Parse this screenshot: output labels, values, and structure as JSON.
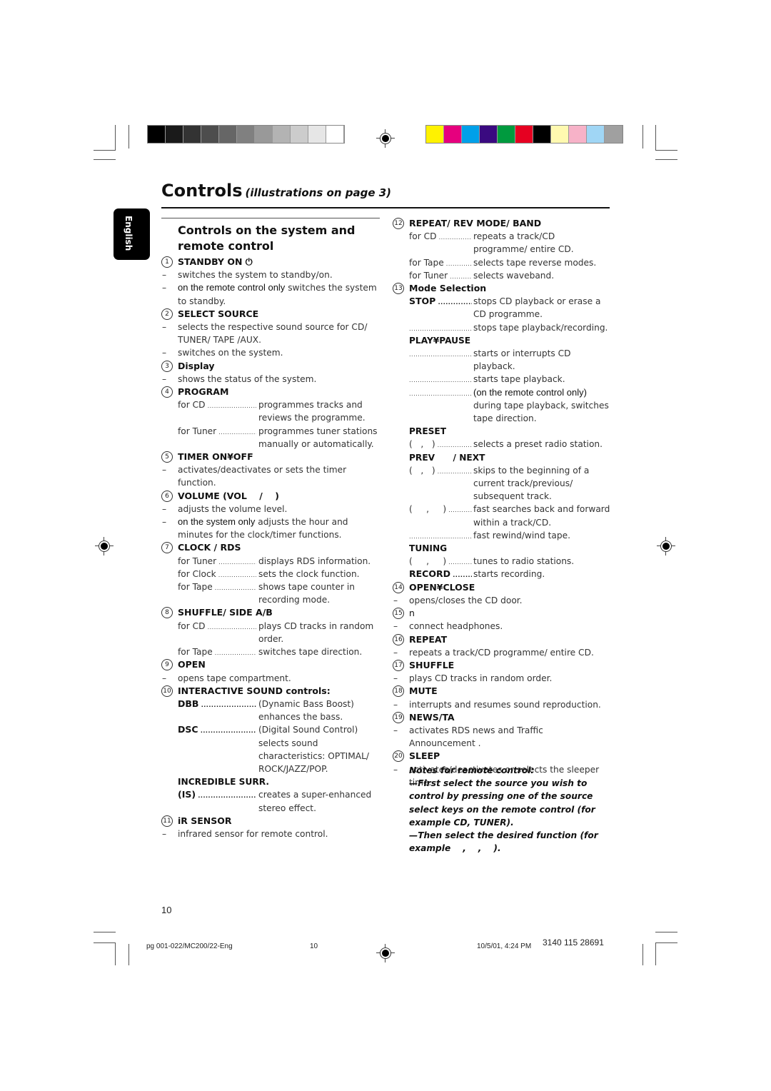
{
  "print_marks": {
    "gray_swatches": [
      "#000000",
      "#1a1a1a",
      "#333333",
      "#4d4d4d",
      "#666666",
      "#808080",
      "#999999",
      "#b3b3b3",
      "#cccccc",
      "#e6e6e6",
      "#ffffff"
    ],
    "color_swatches": [
      "#fff200",
      "#e6007e",
      "#00a0e9",
      "#3a0a80",
      "#009a3e",
      "#e60021",
      "#000000",
      "#fff9b0",
      "#f7b2c8",
      "#a0d6f5",
      "#a0a0a0"
    ]
  },
  "header": {
    "title": "Controls",
    "subtitle": "(illustrations on page 3)",
    "language_tab": "English"
  },
  "left": {
    "section_title_line1": "Controls on the system and",
    "section_title_line2": "remote control",
    "items": {
      "i1": {
        "num": "1",
        "title": "STANDBY ON ⏻",
        "d1": "switches the system to standby/on.",
        "d2_hl": "on the remote control only",
        "d2": "switches the system to standby."
      },
      "i2": {
        "num": "2",
        "title": "SELECT SOURCE",
        "d1": "selects the respective sound source for CD/ TUNER/ TAPE /AUX.",
        "d2": "switches on the system."
      },
      "i3": {
        "num": "3",
        "title": "Display",
        "d1": "shows the status of the system."
      },
      "i4": {
        "num": "4",
        "title": "PROGRAM",
        "r1_label": "for CD",
        "r1_text": "programmes tracks and reviews the programme.",
        "r2_label": "for Tuner",
        "r2_text": "programmes tuner stations manually or automatically."
      },
      "i5": {
        "num": "5",
        "title": "TIMER ON¥OFF",
        "d1": "activates/deactivates or sets the timer function."
      },
      "i6": {
        "num": "6",
        "title": "VOLUME (VOL    /    )",
        "d1": "adjusts the volume level.",
        "d2_hl": "on the system only",
        "d2": "adjusts the hour and minutes for the clock/timer functions."
      },
      "i7": {
        "num": "7",
        "title": "CLOCK / RDS",
        "r1_label": "for Tuner",
        "r1_text": "displays RDS information.",
        "r2_label": "for Clock",
        "r2_text": "sets the clock function.",
        "r3_label": "for Tape",
        "r3_text": "shows tape counter in recording mode."
      },
      "i8": {
        "num": "8",
        "title": "SHUFFLE/ SIDE A/B",
        "r1_label": "for CD",
        "r1_text": "plays CD tracks in random order.",
        "r2_label": "for Tape",
        "r2_text": "switches tape direction."
      },
      "i9": {
        "num": "9",
        "title": "OPEN",
        "d1": "opens tape compartment."
      },
      "i10": {
        "num": "10",
        "title": "INTERACTIVE SOUND controls:",
        "r1_label": "DBB",
        "r1_text": "(Dynamic Bass Boost) enhances the bass.",
        "r2_label": "DSC",
        "r2_text": "(Digital Sound Control) selects sound characteristics: OPTIMAL/ ROCK/JAZZ/POP.",
        "sub_head": "INCREDIBLE SURR.",
        "r3_label": "(IS)",
        "r3_text": "creates a super-enhanced stereo effect."
      },
      "i11": {
        "num": "11",
        "title": "iR SENSOR",
        "d1": "infrared sensor for remote control."
      }
    }
  },
  "right": {
    "items": {
      "i12": {
        "num": "12",
        "title": "REPEAT/ REV MODE/ BAND",
        "r1_label": "for CD",
        "r1_text": "repeats a track/CD programme/ entire CD.",
        "r2_label": "for Tape",
        "r2_text": "selects tape reverse modes.",
        "r3_label": "for Tuner",
        "r3_text": "selects waveband."
      },
      "i13": {
        "num": "13",
        "title": "Mode Selection",
        "stop_label": "STOP",
        "stop_r1": "stops CD playback or erase a CD programme.",
        "stop_r2": "stops tape playback/recording.",
        "play_head": "PLAY¥PAUSE",
        "play_r1": "starts or interrupts CD playback.",
        "play_r2": "starts tape playback.",
        "play_r3_hl": "(on the remote control only)",
        "play_r3": "during tape playback, switches tape direction.",
        "preset_head": "PRESET",
        "preset_label": "(   ,   )",
        "preset_text": "selects a preset radio station.",
        "prevnext_head": "PREV      / NEXT",
        "pn_r1_label": "(   ,   )",
        "pn_r1_text": "skips to the beginning of a current track/previous/ subsequent track.",
        "pn_r2_label": "(     ,     )",
        "pn_r2_text": "fast searches back and forward within a track/CD.",
        "pn_r3_text": "fast rewind/wind tape.",
        "tuning_head": "TUNING",
        "tuning_label": "(     ,     )",
        "tuning_text": "tunes to radio stations.",
        "record_label": "RECORD",
        "record_text": "starts recording."
      },
      "i14": {
        "num": "14",
        "title": "OPEN¥CLOSE",
        "d1": "opens/closes the CD door."
      },
      "i15": {
        "num": "15",
        "title": "n",
        "d1": "connect headphones."
      },
      "i16": {
        "num": "16",
        "title": "REPEAT",
        "d1": "repeats a track/CD programme/ entire CD."
      },
      "i17": {
        "num": "17",
        "title": "SHUFFLE",
        "d1": "plays CD tracks in random order."
      },
      "i18": {
        "num": "18",
        "title": "MUTE",
        "d1": "interrupts and resumes sound reproduction."
      },
      "i19": {
        "num": "19",
        "title": "NEWS/TA",
        "d1": "activates RDS news and Traffic Announcement ."
      },
      "i20": {
        "num": "20",
        "title": "SLEEP",
        "d1": "activates/deactivates or selects the sleeper time."
      }
    },
    "notes": {
      "heading": "Notes for remote control:",
      "n1": "—First select the source you wish to control by pressing one of the source select keys on the remote control (for example CD, TUNER).",
      "n2": "—Then select the desired function (for example    ,    ,    )."
    }
  },
  "page_number": "10",
  "footer": {
    "file": "pg 001-022/MC200/22-Eng",
    "page": "10",
    "datetime": "10/5/01, 4:24 PM",
    "code": "3140 115 28691"
  }
}
